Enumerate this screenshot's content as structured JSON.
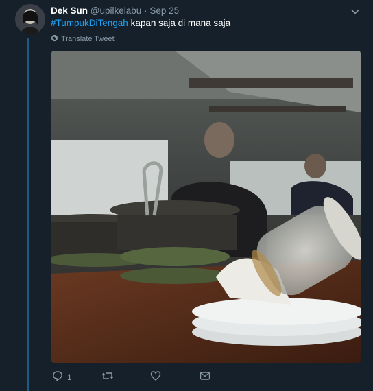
{
  "tweet": {
    "display_name": "Dek Sun",
    "handle": "@upilkelabu",
    "separator": "·",
    "date": "Sep 25",
    "hashtag": "#TumpukDiTengah",
    "text": " kapan saja di mana saja",
    "translate_label": "Translate Tweet"
  },
  "actions": {
    "reply_count": "1",
    "retweet_count": "",
    "like_count": ""
  },
  "colors": {
    "background": "#15202b",
    "accent": "#1da1f2",
    "muted": "#8899a6",
    "thread_line": "#1f5a82"
  },
  "icons": [
    "chevron-down-icon",
    "globe-icon",
    "reply-icon",
    "retweet-icon",
    "like-icon",
    "dm-icon"
  ]
}
